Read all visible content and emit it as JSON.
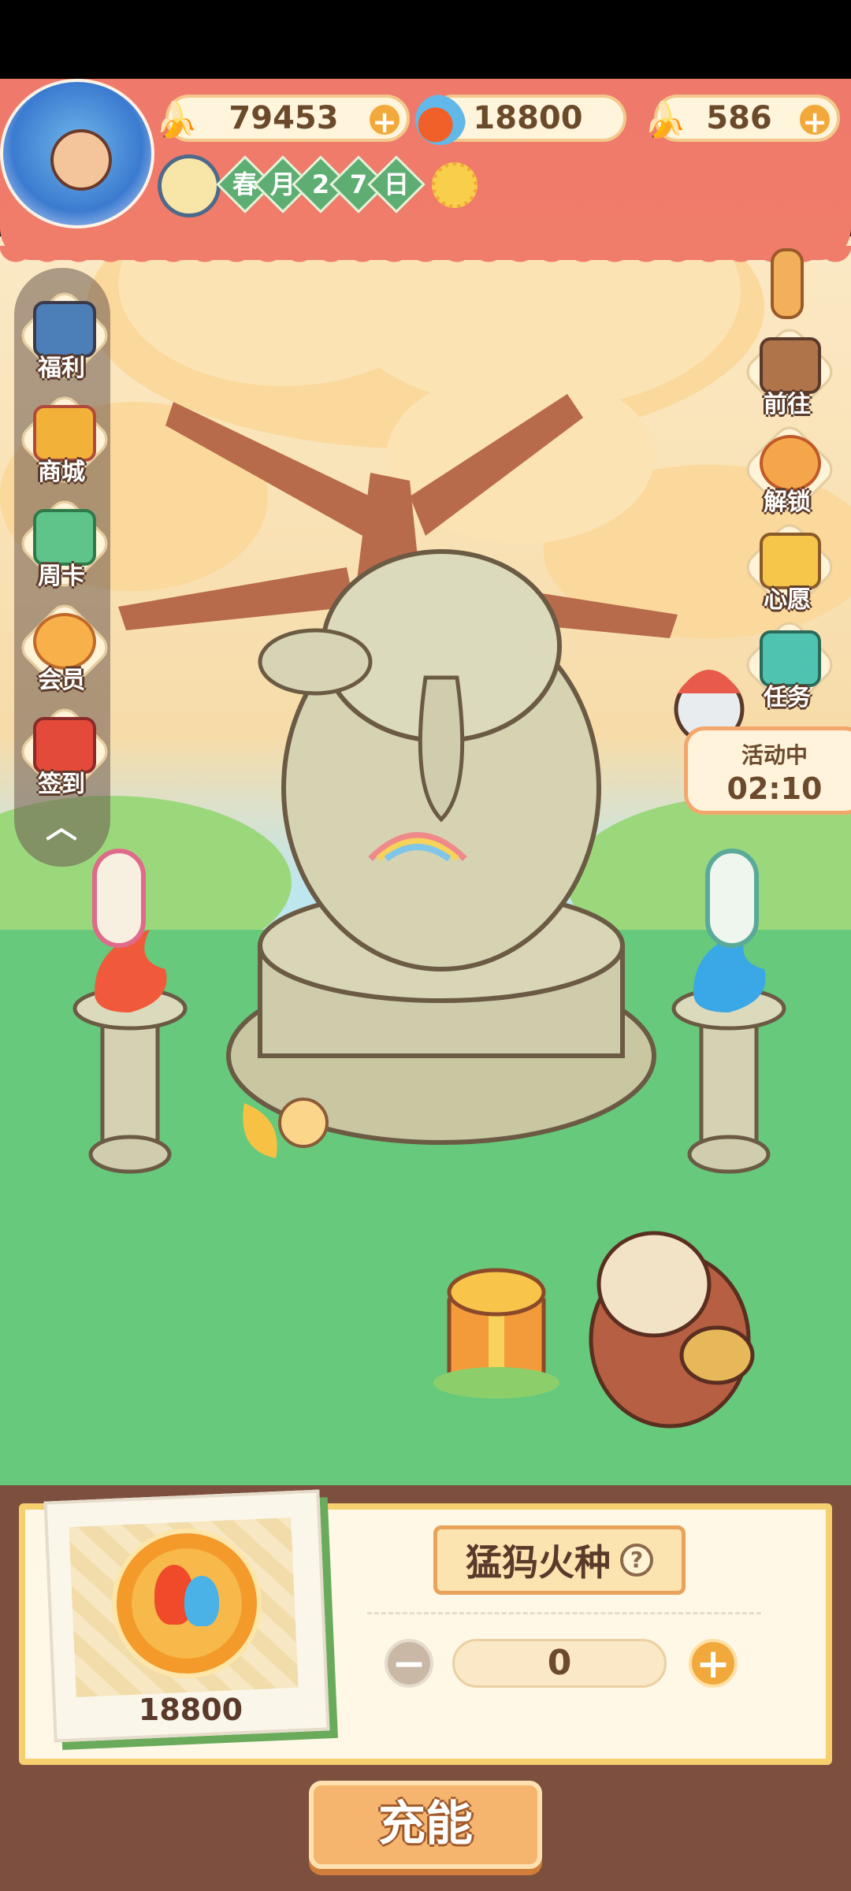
{
  "currencies": {
    "banana": {
      "value": "79453",
      "icon": "banana-icon"
    },
    "fire": {
      "value": "18800",
      "icon": "flame-icon"
    },
    "blue_banana": {
      "value": "586",
      "icon": "blue-banana-icon"
    }
  },
  "calendar": {
    "season": "春",
    "month_label": "月",
    "day_digits": [
      "2",
      "7"
    ],
    "day_label": "日",
    "weather_icon": "sun-icon"
  },
  "left_menu": {
    "items": [
      {
        "label": "福利",
        "icon": "tv-icon"
      },
      {
        "label": "商城",
        "icon": "shop-icon"
      },
      {
        "label": "周卡",
        "icon": "week-card-icon"
      },
      {
        "label": "会员",
        "icon": "member-icon"
      },
      {
        "label": "签到",
        "icon": "check-in-icon"
      }
    ],
    "collapse_icon": "chevron-up-icon"
  },
  "right_menu": {
    "items": [
      {
        "label": "前往",
        "icon": "signboard-icon"
      },
      {
        "label": "解锁",
        "icon": "key-icon"
      },
      {
        "label": "心愿",
        "icon": "heart-book-icon"
      },
      {
        "label": "任务",
        "icon": "task-icon"
      }
    ]
  },
  "activity": {
    "status": "活动中",
    "timer": "02:10"
  },
  "bottom_panel": {
    "card_value": "18800",
    "item_name": "猛犸火种",
    "help_symbol": "?",
    "quantity": "0",
    "minus_symbol": "−",
    "plus_symbol": "+",
    "action_label": "充能"
  },
  "colors": {
    "header": "#f07c6a",
    "bottom_panel": "#7c4f3f",
    "accent_orange": "#f2a93b",
    "grass": "#66c97c"
  }
}
